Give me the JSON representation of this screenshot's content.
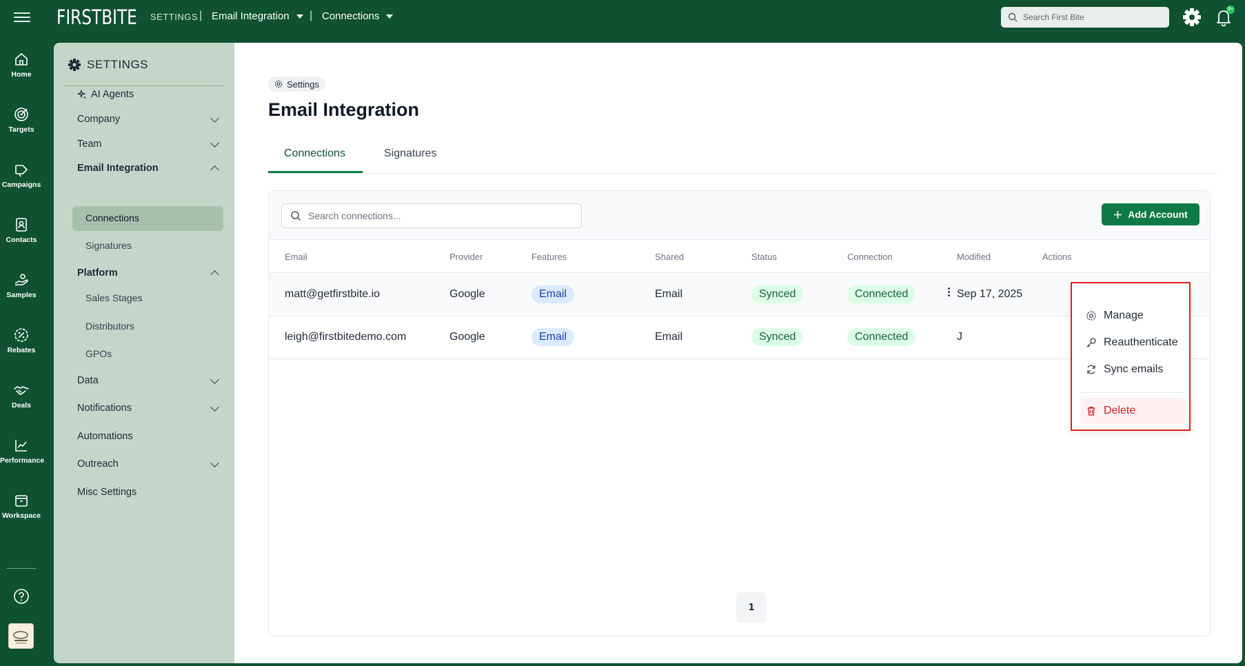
{
  "topbar": {
    "logo": "FIRSTBITE",
    "settings_crumb": "SETTINGS",
    "sep": "|",
    "crumb1": "Email Integration",
    "crumb2": "Connections",
    "search_placeholder": "Search First Bite",
    "badge": "9+"
  },
  "rail": {
    "items": [
      {
        "label": "Home",
        "icon": "home-icon"
      },
      {
        "label": "Targets",
        "icon": "target-icon"
      },
      {
        "label": "Campaigns",
        "icon": "megaphone-icon"
      },
      {
        "label": "Contacts",
        "icon": "contacts-icon"
      },
      {
        "label": "Samples",
        "icon": "hand-icon"
      },
      {
        "label": "Rebates",
        "icon": "percent-badge-icon"
      },
      {
        "label": "Deals",
        "icon": "handshake-icon"
      },
      {
        "label": "Performance",
        "icon": "chart-line-icon"
      },
      {
        "label": "Workspace",
        "icon": "archive-icon"
      }
    ]
  },
  "settings_panel": {
    "title": "SETTINGS",
    "items": {
      "ai_agents": "AI Agents",
      "company": "Company",
      "team": "Team",
      "email_integration": "Email Integration",
      "connections": "Connections",
      "signatures": "Signatures",
      "platform": "Platform",
      "sales_stages": "Sales Stages",
      "distributors": "Distributors",
      "gpos": "GPOs",
      "data": "Data",
      "notifications": "Notifications",
      "automations": "Automations",
      "outreach": "Outreach",
      "misc": "Misc Settings"
    }
  },
  "main": {
    "pill": "Settings",
    "title": "Email Integration",
    "tabs": [
      "Connections",
      "Signatures"
    ],
    "search_placeholder": "Search connections...",
    "add_button": "Add Account",
    "columns": [
      "Email",
      "Provider",
      "Features",
      "Shared",
      "Status",
      "Connection",
      "Modified",
      "Actions"
    ],
    "rows": [
      {
        "email": "matt@getfirstbite.io",
        "provider": "Google",
        "features": "Email",
        "shared": "Email",
        "status": "Synced",
        "connection": "Connected",
        "modified": "Sep 17, 2025"
      },
      {
        "email": "leigh@firstbitedemo.com",
        "provider": "Google",
        "features": "Email",
        "shared": "Email",
        "status": "Synced",
        "connection": "Connected",
        "modified": "J"
      }
    ],
    "page": "1"
  },
  "menu": {
    "manage": "Manage",
    "reauth": "Reauthenticate",
    "sync": "Sync emails",
    "delete": "Delete"
  },
  "colors": {
    "brand": "#0f5132",
    "accent": "#0f7a46",
    "danger": "#c81e1e"
  }
}
